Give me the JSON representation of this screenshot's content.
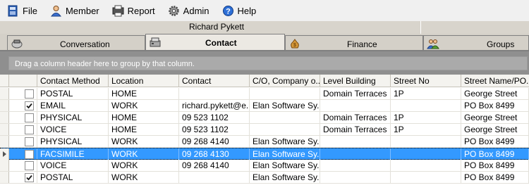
{
  "menu": {
    "items": [
      {
        "label": "File",
        "icon": "file-icon"
      },
      {
        "label": "Member",
        "icon": "member-icon"
      },
      {
        "label": "Report",
        "icon": "report-icon"
      },
      {
        "label": "Admin",
        "icon": "admin-icon"
      },
      {
        "label": "Help",
        "icon": "help-icon"
      }
    ]
  },
  "header": {
    "title": "Richard Pykett"
  },
  "tabs": [
    {
      "label": "Conversation",
      "icon": "conversation-icon",
      "active": false
    },
    {
      "label": "Contact",
      "icon": "contact-icon",
      "active": true
    },
    {
      "label": "Finance",
      "icon": "finance-icon",
      "active": false
    },
    {
      "label": "Groups",
      "icon": "groups-icon",
      "active": false
    }
  ],
  "group_panel": {
    "hint": "Drag a column header here to group by that column."
  },
  "grid": {
    "columns": [
      "Contact Method",
      "Location",
      "Contact",
      "C/O, Company o...",
      "Level Building",
      "Street No",
      "Street Name/PO..."
    ],
    "rows": [
      {
        "checked": false,
        "selected": false,
        "cells": [
          "POSTAL",
          "HOME",
          "",
          "",
          "Domain Terraces",
          "1P",
          "George Street"
        ]
      },
      {
        "checked": true,
        "selected": false,
        "cells": [
          "EMAIL",
          "WORK",
          "richard.pykett@e...",
          "Elan Software Sy...",
          "",
          "",
          "PO Box 8499"
        ]
      },
      {
        "checked": false,
        "selected": false,
        "cells": [
          "PHYSICAL",
          "HOME",
          "09 523 1102",
          "",
          "Domain Terraces",
          "1P",
          "George Street"
        ]
      },
      {
        "checked": false,
        "selected": false,
        "cells": [
          "VOICE",
          "HOME",
          "09 523 1102",
          "",
          "Domain Terraces",
          "1P",
          "George Street"
        ]
      },
      {
        "checked": false,
        "selected": false,
        "cells": [
          "PHYSICAL",
          "WORK",
          "09 268 4140",
          "Elan Software Sy...",
          "",
          "",
          "PO Box 8499"
        ]
      },
      {
        "checked": false,
        "selected": true,
        "cells": [
          "FACSIMILE",
          "WORK",
          "09 268 4130",
          "Elan Software Sy...",
          "",
          "",
          "PO Box 8499"
        ]
      },
      {
        "checked": false,
        "selected": false,
        "cells": [
          "VOICE",
          "WORK",
          "09 268 4140",
          "Elan Software Sy...",
          "",
          "",
          "PO Box 8499"
        ]
      },
      {
        "checked": true,
        "selected": false,
        "cells": [
          "POSTAL",
          "WORK",
          "",
          "Elan Software Sy...",
          "",
          "",
          "PO Box 8499"
        ]
      }
    ]
  },
  "colors": {
    "selection": "#3399ff",
    "group_panel": "#8f8f8f"
  }
}
